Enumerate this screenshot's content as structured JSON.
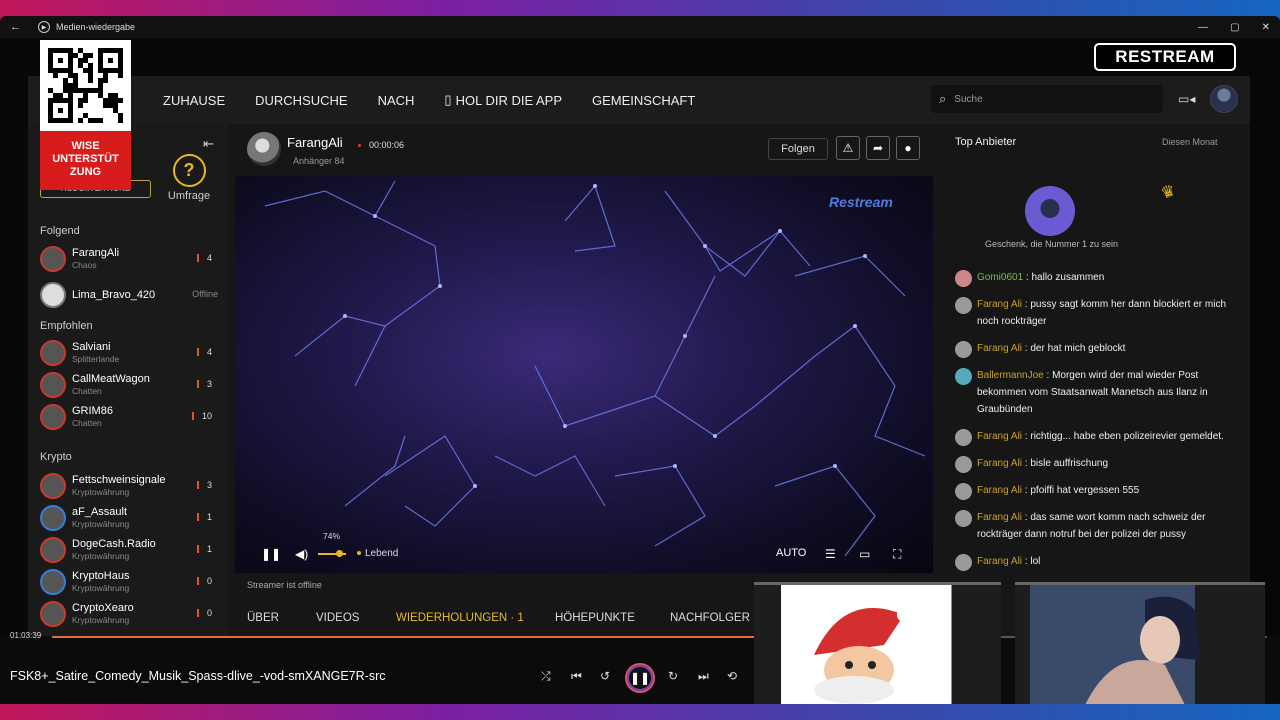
{
  "window": {
    "title": "Medien-wiedergabe"
  },
  "logo": "RESTREAM",
  "qr_badge": {
    "text": "WISE UNTERSTÜT ZUNG"
  },
  "nav": {
    "items": [
      "ZUHAUSE",
      "DURCHSUCHE",
      "NACH",
      "HOL DIR DIE APP",
      "GEMEINSCHAFT"
    ],
    "search_placeholder": "Suche"
  },
  "sidebar": {
    "hol_button": "HOL DIR ZITRONE",
    "poll_label": "Umfrage",
    "sections": {
      "following": "Folgend",
      "recommended": "Empfohlen",
      "crypto": "Krypto"
    },
    "following": [
      {
        "name": "FarangAli",
        "sub": "Chaos",
        "count": "4"
      },
      {
        "name": "Lima_Bravo_420",
        "sub": "",
        "status": "Offline"
      }
    ],
    "recommended": [
      {
        "name": "Salviani",
        "sub": "Splitterlande",
        "count": "4"
      },
      {
        "name": "CallMeatWagon",
        "sub": "Chatten",
        "count": "3"
      },
      {
        "name": "GRIM86",
        "sub": "Chatten",
        "count": "10"
      }
    ],
    "crypto": [
      {
        "name": "Fettschweinsignale",
        "sub": "Kryptowährung",
        "count": "3"
      },
      {
        "name": "aF_Assault",
        "sub": "Kryptowährung",
        "count": "1"
      },
      {
        "name": "DogeCash.Radio",
        "sub": "Kryptowährung",
        "count": "1"
      },
      {
        "name": "KryptoHaus",
        "sub": "Kryptowährung",
        "count": "0"
      },
      {
        "name": "CryptoXearo",
        "sub": "Kryptowährung",
        "count": "0"
      }
    ]
  },
  "channel": {
    "name": "FarangAli",
    "time": "00:00:06",
    "followers": "Anhänger   84",
    "follow_button": "Folgen"
  },
  "video": {
    "watermark": "Restream",
    "volume_pct": "74%",
    "volume_level": 0.74,
    "live_label": "Lebend",
    "quality": "AUTO",
    "offline_note": "Streamer ist offline"
  },
  "tabs": [
    "ÜBER",
    "VIDEOS",
    "WIEDERHOLUNGEN · 1",
    "HÖHEPUNKTE",
    "NACHFOLGER ·"
  ],
  "chat": {
    "header": "Top Anbieter",
    "period": "Diesen Monat",
    "top_caption": "Geschenk, die Nummer 1 zu sein",
    "messages": [
      {
        "user": "Gomi0601",
        "text": "hallo zusammen"
      },
      {
        "user": "Farang Ali",
        "text": "pussy sagt komm her dann blockiert er mich noch rockträger"
      },
      {
        "user": "Farang Ali",
        "text": "der hat mich geblockt"
      },
      {
        "user": "BallermannJoe",
        "text": "Morgen wird der mal wieder Post bekommen vom Staatsanwalt Manetsch aus Ilanz in Graubünden"
      },
      {
        "user": "Farang Ali",
        "text": "richtigg... habe eben polizeirevier gemeldet."
      },
      {
        "user": "Farang Ali",
        "text": "bisle auffrischung"
      },
      {
        "user": "Farang Ali",
        "text": "pfoiffi hat vergessen 555"
      },
      {
        "user": "Farang Ali",
        "text": "das same wort komm nach schweiz der rockträger dann notruf bei der polizei der pussy"
      },
      {
        "user": "Farang Ali",
        "text": "lol"
      }
    ]
  },
  "player": {
    "time": "01:03:39",
    "progress": 0.62,
    "title": "FSK8+_Satire_Comedy_Musik_Spass-dlive_-vod-smXANGE7R-src"
  },
  "colors": {
    "accent": "#e8b824",
    "live_red": "#e53935",
    "progress": "#e56a3a",
    "badge_red": "#d81b1b"
  }
}
